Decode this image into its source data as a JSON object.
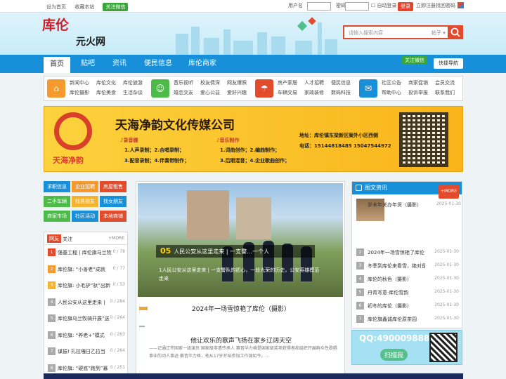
{
  "topbar": {
    "homepage": "设为首页",
    "favorite": "收藏本站",
    "wechat": "关注微信",
    "username_label": "用户名",
    "password_label": "密码",
    "auto_login": "自动登录",
    "login_btn": "登录",
    "register": "立即注册",
    "forgot": "找回密码"
  },
  "logo": {
    "mark": "库伦",
    "name": "元火网"
  },
  "search": {
    "placeholder": "请输入搜索内容",
    "select": "帖子"
  },
  "nav": {
    "items": [
      "首页",
      "贴吧",
      "资讯",
      "便民信息",
      "库伦商家"
    ],
    "wechat": "关注微信",
    "quick": "快捷导航"
  },
  "categories": [
    {
      "links": [
        "新闻中心",
        "库伦文化",
        "库伦旅游",
        "库伦摄影",
        "库伦美食",
        "生活杂谈"
      ]
    },
    {
      "links": [
        "音乐视听",
        "校友情深",
        "网友爆照",
        "婚恋交友",
        "爱心公益",
        "爱好兴趣"
      ]
    },
    {
      "links": [
        "房产家居",
        "人才招聘",
        "便民信息",
        "车辆交易",
        "家政装修",
        "数码科技"
      ]
    },
    {
      "links": [
        "社区公告",
        "商家促销",
        "会员交流",
        "帮助中心",
        "投诉举报",
        "联系我们"
      ]
    }
  ],
  "banner": {
    "title": "天海净韵文化传媒公司",
    "brand": "天海净韵",
    "sec1": "♪录音棚",
    "sec2": "♪音乐制作",
    "lines1": [
      "1.人声录制；2.合唱录制；",
      "3.配音录制；4.伴奏带制作；"
    ],
    "lines2": [
      "1.词曲创作；2.编曲制作；",
      "3.后期混音；4.企业歌曲创作；"
    ],
    "addr": "地址：库伦镇东梁新区案外小区西侧",
    "phone": "电话：15144818485  15047544972"
  },
  "quickgrid": [
    "求职信息",
    "企业招聘",
    "房屋租售",
    "二手车辆",
    "找男朋友",
    "找女朋友",
    "商家市场",
    "社区活动",
    "本地商铺"
  ],
  "friends": {
    "tag": "网友",
    "title": "关注",
    "more": "+MORE",
    "rows": [
      {
        "t": "强基工程 | 库伦旗马兰牧",
        "c": "0 / 78"
      },
      {
        "t": "库伦旗: “小善老”成就",
        "c": "0 / 77"
      },
      {
        "t": "库伦旗: 小毛驴”驮”出新",
        "c": "0 / 53"
      },
      {
        "t": "人民公安从这里走来 |",
        "c": "0 / 284"
      },
      {
        "t": "库伦旗乌兰牧骑开展”送",
        "c": "0 / 264"
      },
      {
        "t": "库伦旗: “养老+”模式",
        "c": "0 / 263"
      },
      {
        "t": "谋振! 扎拉嘎日乙拉当",
        "c": "0 / 264"
      },
      {
        "t": "库伦旗: “硬底”跑到”暴",
        "c": "0 / 251"
      }
    ]
  },
  "slide": {
    "index": "05",
    "caption": "人民公安从这里走来 | 一支警…一个人",
    "sub": "1人民公安从这里走来 | 一支警队的初心，一段光荣的历史，公安英雄模范走来"
  },
  "news": {
    "headline1": "2024年一场雪惊艳了库伦（摄影）",
    "headline2": "他让欢乐的歌声飞扬在家乡辽阔天空",
    "desc": "——记通辽市国家一级演员 国家级非遗传承人 赛音毕力格是国家级奖项获得者和组织开展群众性歌唱事业的动人事迹 赛音毕力格，他从17岁开始参加工作源如今。…"
  },
  "right": {
    "title": "图文资讯",
    "more": "+MORE",
    "featured": {
      "t": "岁末年关办年货（摄影）",
      "d": "2025-01-30"
    },
    "rows": [
      {
        "n": "2",
        "t": "2024年一场雪惊艳了库伦",
        "d": "2025-01-30"
      },
      {
        "n": "3",
        "t": "冬季到库伦来看雪，绝对是",
        "d": "2025-01-30"
      },
      {
        "n": "4",
        "t": "库伦的秋色（摄影）",
        "d": "2025-01-30"
      },
      {
        "n": "5",
        "t": "丹青写意·库伦雪韵",
        "d": "2025-01-30"
      },
      {
        "n": "6",
        "t": "初冬的库伦（摄影）",
        "d": "2025-01-30"
      },
      {
        "n": "7",
        "t": "库伦旗鑫诚库伦原茶园",
        "d": "2025-01-30"
      }
    ]
  },
  "qq": {
    "number": "QQ:490009888",
    "scan": "扫描我"
  },
  "colors": {
    "accent": "#1790d9",
    "red": "#e24b2c",
    "banner": "#fcd23d"
  }
}
